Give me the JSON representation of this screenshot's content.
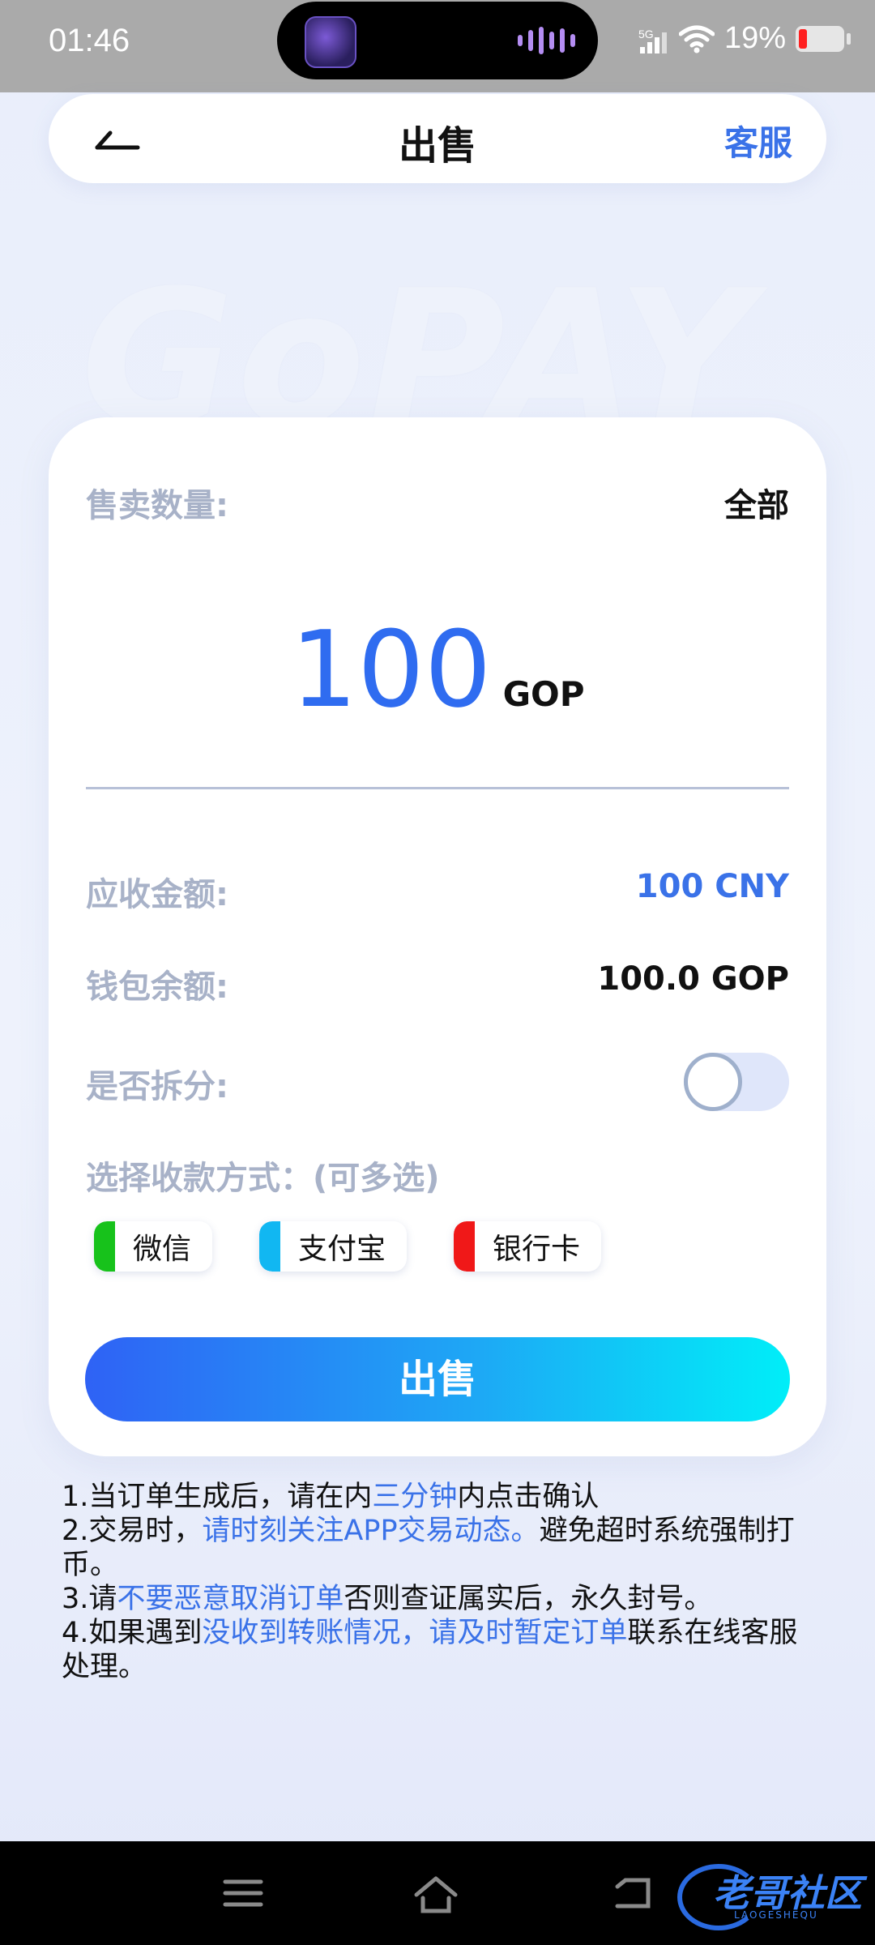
{
  "status_bar": {
    "time": "01:46",
    "network": "5G",
    "battery_percent": "19%",
    "battery_level": 0.19,
    "battery_color": "#ff2020"
  },
  "header": {
    "back_icon": "back-arrow-icon",
    "title": "出售",
    "service": "客服"
  },
  "watermark_text": "GoPAY",
  "form": {
    "quantity_label": "售卖数量:",
    "all_button": "全部",
    "amount": "100",
    "amount_unit": "GOP",
    "receivable_label": "应收金额:",
    "receivable_value": "100 CNY",
    "balance_label": "钱包余额:",
    "balance_value": "100.0 GOP",
    "split_label": "是否拆分:",
    "split_enabled": false,
    "payment_label": "选择收款方式：(可多选)",
    "payment_methods": [
      {
        "label": "微信",
        "color": "#17c21b"
      },
      {
        "label": "支付宝",
        "color": "#11b7f2"
      },
      {
        "label": "银行卡",
        "color": "#f01818"
      }
    ],
    "submit_label": "出售"
  },
  "notes": [
    {
      "a": "1.当订单生成后，请在内",
      "b": "三分钟",
      "c": "内点击确认"
    },
    {
      "a": "2.交易时，",
      "b": "请时刻关注APP交易动态。",
      "c": "避免超时系统强制打币。"
    },
    {
      "a": "3.请",
      "b": "不要恶意取消订单",
      "c": "否则查证属实后，永久封号。"
    },
    {
      "a": "4.如果遇到",
      "b": "没收到转账情况，请及时暂定订单",
      "c": "联系在线客服处理。"
    }
  ],
  "nav_bar": {
    "icons": [
      "menu-icon",
      "home-icon",
      "back-icon"
    ],
    "watermark_logo": "老哥社区",
    "watermark_logo_sub": "LAOGESHEQU"
  },
  "colors": {
    "accent": "#3a72e8",
    "amount": "#2f6cf0",
    "label": "#a8b2c8"
  }
}
